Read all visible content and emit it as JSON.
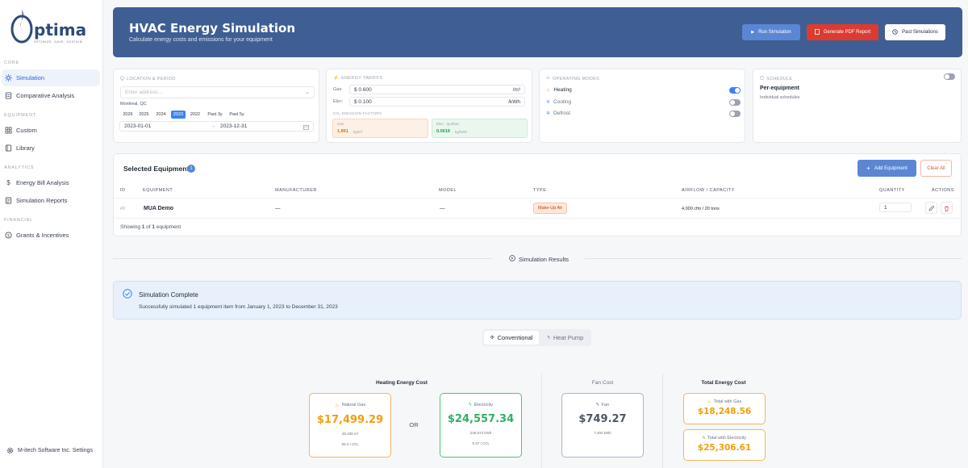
{
  "brand": {
    "name": "ptima",
    "tagline": "OPTIMIZE. SAVE. SUSTAIN"
  },
  "sidebar": {
    "sections": [
      {
        "title": "CORE",
        "items": [
          {
            "label": "Simulation",
            "icon": "sun-icon",
            "active": true
          },
          {
            "label": "Comparative Analysis",
            "icon": "document-icon",
            "active": false
          }
        ]
      },
      {
        "title": "EQUIPMENT",
        "items": [
          {
            "label": "Custom",
            "icon": "grid-icon",
            "active": false
          },
          {
            "label": "Library",
            "icon": "book-icon",
            "active": false
          }
        ]
      },
      {
        "title": "ANALYTICS",
        "items": [
          {
            "label": "Energy Bill Analysis",
            "icon": "dollar-icon",
            "active": false
          },
          {
            "label": "Simulation Reports",
            "icon": "report-icon",
            "active": false
          }
        ]
      },
      {
        "title": "FINANCIAL",
        "items": [
          {
            "label": "Grants & Incentives",
            "icon": "coin-icon",
            "active": false
          }
        ]
      }
    ],
    "settings_label": "M-itech Software Inc. Settings"
  },
  "header": {
    "title": "HVAC Energy Simulation",
    "subtitle": "Calculate energy costs and emissions for your equipment",
    "run_label": "Run Simulation",
    "pdf_label": "Generate PDF Report",
    "past_label": "Past Simulations"
  },
  "location": {
    "title": "LOCATION & PERIOD",
    "address_placeholder": "Enter address...",
    "city": "Montreal, QC",
    "years": [
      "2026",
      "2025",
      "2024",
      "2023",
      "2022",
      "Past 3y",
      "Past 5y"
    ],
    "selected_year": "2023",
    "start_date": "2023-01-01",
    "arrow": "→",
    "end_date": "2023-12-31"
  },
  "tariffs": {
    "title": "ENERGY TARIFFS",
    "gas_label": "Gas:",
    "gas_value": "$ 0.600",
    "gas_unit": "/m³",
    "elec_label": "Elec:",
    "elec_value": "$ 0.100",
    "elec_unit": "/kWh",
    "emission_title": "CO₂ EMISSION FACTORS",
    "gas_factor_label": "Gas",
    "gas_factor_value": "1.891",
    "gas_factor_unit": "kg/m³",
    "elec_factor_label": "Elec - Québec",
    "elec_factor_value": "0.0019",
    "elec_factor_unit": "kg/kWh"
  },
  "modes": {
    "title": "OPERATING MODES",
    "items": [
      {
        "label": "Heating",
        "on": true,
        "icon": "flame-icon"
      },
      {
        "label": "Cooling",
        "on": false,
        "icon": "snowflake-icon"
      },
      {
        "label": "Defrost",
        "on": false,
        "icon": "defrost-icon"
      }
    ]
  },
  "schedule": {
    "title": "SCHEDULE",
    "mode": "Per-equipment",
    "desc": "Individual schedules",
    "toggle_on": false
  },
  "equipment": {
    "title": "Selected Equipment",
    "count": "1",
    "add_label": "Add Equipment",
    "clear_label": "Clear All",
    "columns": [
      "ID",
      "EQUIPMENT",
      "MANUFACTURER",
      "MODEL",
      "TYPE",
      "AIRFLOW / CAPACITY",
      "QUANTITY",
      "ACTIONS"
    ],
    "rows": [
      {
        "id": "#2",
        "name": "MUA Demo",
        "manufacturer": "—",
        "model": "—",
        "type": "Make-Up Air",
        "airflow": "4,000 cfm / 20 tons",
        "quantity": "1"
      }
    ],
    "showing_prefix": "Showing ",
    "showing_count": "1",
    "showing_mid": " of ",
    "showing_total": "1",
    "showing_suffix": " equipment"
  },
  "results": {
    "divider_label": "Simulation Results",
    "complete_title": "Simulation Complete",
    "complete_msg": "Successfully simulated 1 equipment item from January 1, 2023 to December 31, 2023",
    "tabs": [
      {
        "label": "Conventional",
        "active": true
      },
      {
        "label": "Heat Pump",
        "active": false
      }
    ],
    "heating_title": "Heating Energy Cost",
    "gas_card": {
      "label": "Natural Gas",
      "value": "$17,499.29",
      "sub1": "29,165 m³",
      "sub2": "55.2 t CO₂"
    },
    "or_label": "OR",
    "elec_card": {
      "label": "Electricity",
      "value": "$24,557.34",
      "sub1": "245,573 kWh",
      "sub2": "0.47 t CO₂"
    },
    "fan_title": "Fan Cost",
    "fan_card": {
      "label": "Fan",
      "value": "$749.27",
      "sub1": "7,493 kWh"
    },
    "total_title": "Total Energy Cost",
    "total_gas": {
      "label": "Total with Gas",
      "value": "$18,248.56"
    },
    "total_elec": {
      "label": "Total with Electricity",
      "value": "$25,306.61"
    }
  },
  "colors": {
    "primary": "#3f5e93",
    "accent": "#3b82f6",
    "gas": "#f59e0b",
    "electric": "#22c55e",
    "danger": "#dc2626"
  }
}
